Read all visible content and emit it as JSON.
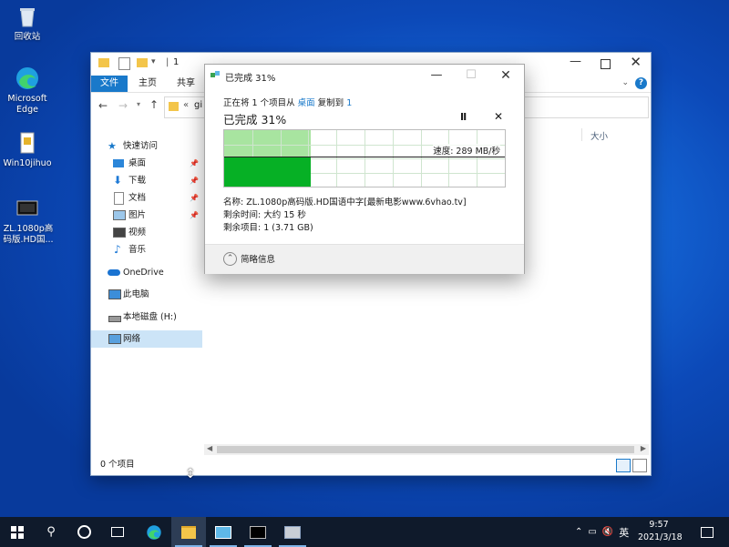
{
  "desktop": {
    "icons": [
      {
        "label": "回收站"
      },
      {
        "label": "Microsoft Edge"
      },
      {
        "label": "Win10jihuo"
      },
      {
        "label": "ZL.1080p高码版.HD国..."
      }
    ]
  },
  "explorer": {
    "title": "1",
    "ribbon_tabs": [
      "文件",
      "主页",
      "共享"
    ],
    "address_prefix": "«",
    "address_text": "gi",
    "column_header_size": "大小",
    "nav": {
      "quick_access": "快速访问",
      "desktop": "桌面",
      "downloads": "下载",
      "documents": "文档",
      "pictures": "图片",
      "videos": "视频",
      "music": "音乐",
      "onedrive": "OneDrive",
      "this_pc": "此电脑",
      "local_disk": "本地磁盘 (H:)",
      "network": "网络"
    },
    "status_items": "0 个项目"
  },
  "dialog": {
    "title": "已完成 31%",
    "copy_line": {
      "prefix": "正在将 1 个项目从",
      "source": "桌面",
      "middle": "复制到",
      "dest": "1"
    },
    "progress_heading": "已完成 31%",
    "progress_fraction": 0.31,
    "speed_label": "速度: 289 MB/秒",
    "name_line": "名称: ZL.1080p高码版.HD国语中字[最新电影www.6vhao.tv]",
    "time_left": "剩余时间: 大约 15 秒",
    "items_left": "剩余项目: 1 (3.71 GB)",
    "less_details": "简略信息"
  },
  "taskbar": {
    "ime": "英",
    "time": "9:57",
    "date": "2021/3/18"
  },
  "colors": {
    "accent": "#1979ca",
    "progress_fill": "#06b025",
    "progress_done_bg": "#a8e4a0",
    "taskbar_bg": "#0f1a2b"
  }
}
